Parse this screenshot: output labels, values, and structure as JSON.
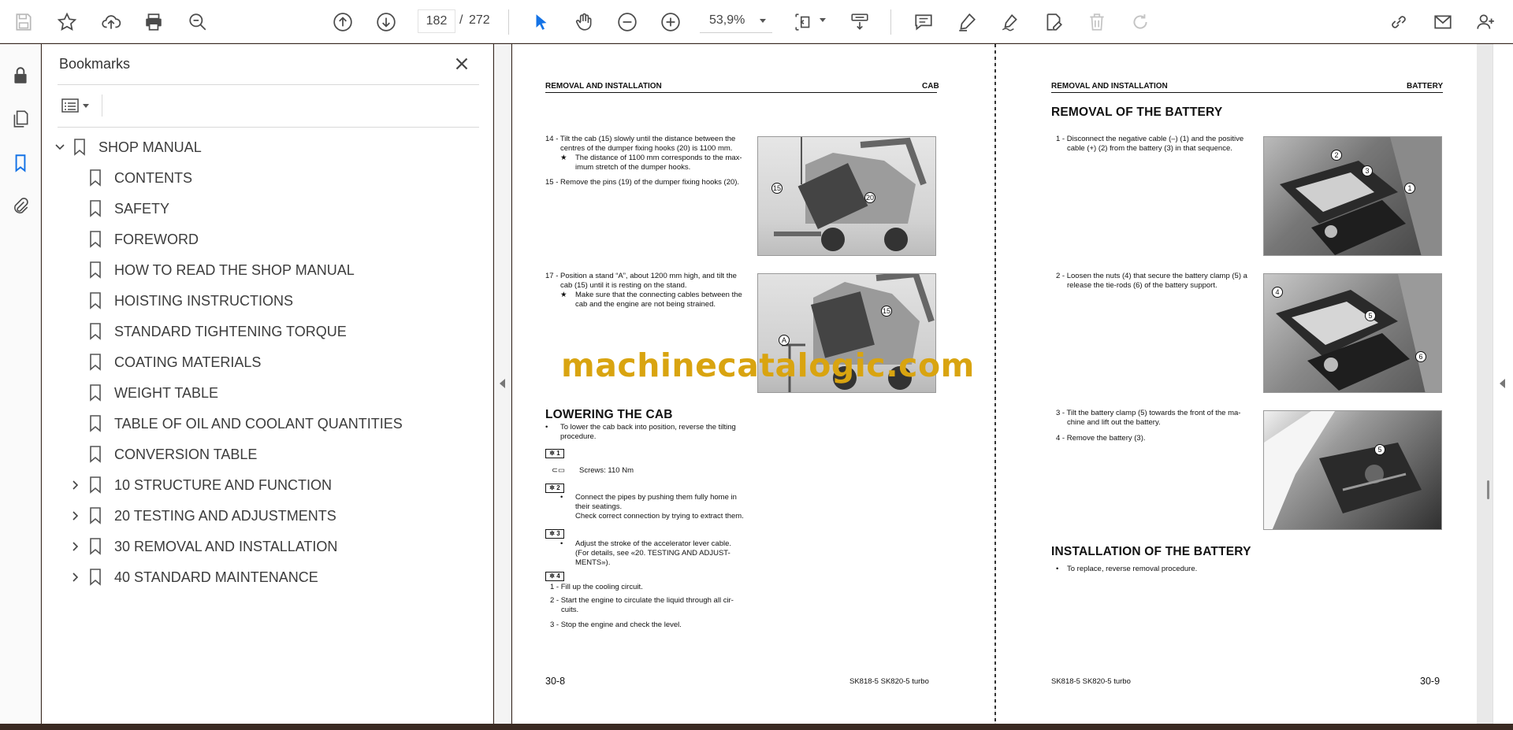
{
  "toolbar": {
    "page_current": "182",
    "page_separator": "/",
    "page_total": "272",
    "zoom": "53,9%"
  },
  "bookmarks": {
    "title": "Bookmarks",
    "items": [
      {
        "label": "SHOP MANUAL",
        "level": 0,
        "expandable": true,
        "expanded": true
      },
      {
        "label": "CONTENTS",
        "level": 1,
        "expandable": false
      },
      {
        "label": "SAFETY",
        "level": 1,
        "expandable": false
      },
      {
        "label": "FOREWORD",
        "level": 1,
        "expandable": false
      },
      {
        "label": "HOW TO READ THE SHOP MANUAL",
        "level": 1,
        "expandable": false
      },
      {
        "label": "HOISTING INSTRUCTIONS",
        "level": 1,
        "expandable": false
      },
      {
        "label": "STANDARD TIGHTENING TORQUE",
        "level": 1,
        "expandable": false
      },
      {
        "label": "COATING MATERIALS",
        "level": 1,
        "expandable": false
      },
      {
        "label": "WEIGHT TABLE",
        "level": 1,
        "expandable": false
      },
      {
        "label": "TABLE OF OIL AND COOLANT QUANTITIES",
        "level": 1,
        "expandable": false
      },
      {
        "label": "CONVERSION TABLE",
        "level": 1,
        "expandable": false
      },
      {
        "label": "10 STRUCTURE AND FUNCTION",
        "level": 1,
        "expandable": true
      },
      {
        "label": "20 TESTING AND ADJUSTMENTS",
        "level": 1,
        "expandable": true
      },
      {
        "label": "30 REMOVAL AND INSTALLATION",
        "level": 1,
        "expandable": true
      },
      {
        "label": "40 STANDARD MAINTENANCE",
        "level": 1,
        "expandable": true
      }
    ]
  },
  "left_page": {
    "header_left": "REMOVAL AND INSTALLATION",
    "header_right": "CAB",
    "step14": "14 - Tilt the cab (15) slowly until the distance between the",
    "step14b": "centres of the dumper fixing hooks (20) is 1100 mm.",
    "step14_note1": "The distance of 1100 mm corresponds to the max-",
    "step14_note2": "imum stretch of the dumper hooks.",
    "step15": "15 - Remove the pins (19) of the dumper fixing hooks (20).",
    "step17": "17 - Position a stand “A”, about 1200 mm high, and tilt the",
    "step17b": "cab (15) until it is resting on the stand.",
    "step17_note1": "Make sure that the connecting cables between the",
    "step17_note2": "cab and the engine are not being strained.",
    "lowering_title": "LOWERING THE CAB",
    "lowering_1": "To lower the cab back into position, reverse the tilting",
    "lowering_2": "procedure.",
    "badge1": "1",
    "screws": "Screws: 110 Nm",
    "badge2": "2",
    "pipes1": "Connect the pipes by pushing them fully home in",
    "pipes2": "their seatings.",
    "pipes3": "Check correct connection by trying to extract them.",
    "badge3": "3",
    "accel1": "Adjust the stroke of the accelerator lever cable.",
    "accel2": "(For details, see «20. TESTING AND ADJUST-",
    "accel3": "MENTS»).",
    "badge4": "4",
    "fill": "1 - Fill up the cooling circuit.",
    "start1": "2 - Start the engine to circulate the liquid through all cir-",
    "start2": "cuits.",
    "stop": "3 - Stop the engine and check the level.",
    "page_num": "30-8",
    "model": "SK818-5  SK820-5 turbo",
    "callouts": {
      "c15a": "15",
      "c20": "20",
      "c15b": "15",
      "cA": "A"
    }
  },
  "right_page": {
    "header_left": "REMOVAL AND INSTALLATION",
    "header_right": "BATTERY",
    "removal_title": "REMOVAL OF THE BATTERY",
    "r1a": "1 - Disconnect the negative cable (–) (1) and the positive",
    "r1b": "cable (+) (2) from the battery (3) in that sequence.",
    "r2a": "2 - Loosen the nuts (4) that secure the battery clamp (5) a",
    "r2b": "release the tie-rods (6) of the battery support.",
    "r3a": "3 - Tilt the battery clamp (5) towards the front of the ma-",
    "r3b": "chine and lift out the battery.",
    "r4": "4 - Remove the battery (3).",
    "install_title": "INSTALLATION OF THE BATTERY",
    "install_1": "To replace, reverse removal procedure.",
    "page_num": "30-9",
    "model": "SK818-5  SK820-5 turbo",
    "callouts": {
      "c2": "2",
      "c3": "3",
      "c1": "1",
      "c4": "4",
      "c5a": "5",
      "c6": "6",
      "c5b": "5"
    }
  },
  "watermark": "machinecatalogic.com",
  "colors": {
    "accent_blue": "#1473e6",
    "watermark": "#d9a410",
    "icon_gray": "#4b4b4b"
  }
}
